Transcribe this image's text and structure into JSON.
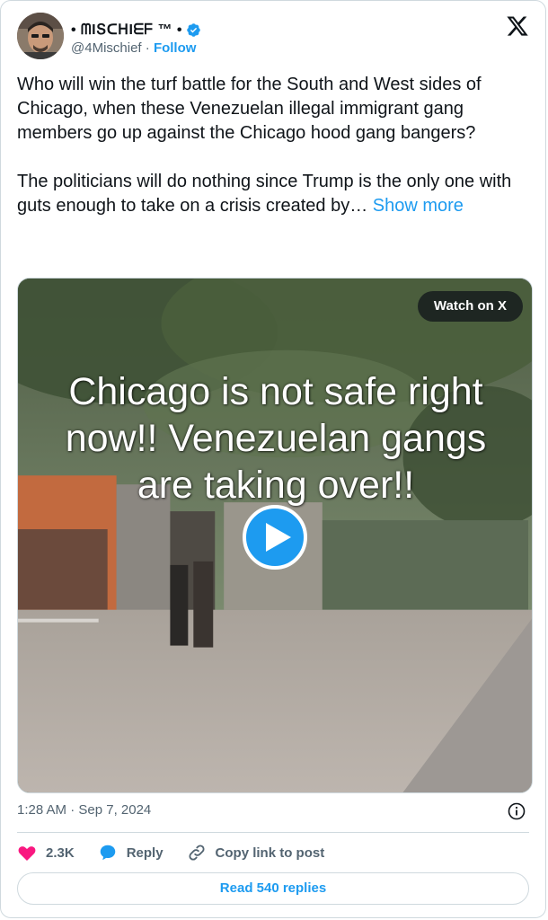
{
  "author": {
    "display_name": "• ᗰIՏᑕᕼIᗴᖴ ™ •",
    "handle": "@4Mischief",
    "separator": "·",
    "follow_label": "Follow"
  },
  "tweet": {
    "text": "Who will win the turf battle for the South and West sides of Chicago, when these Venezuelan illegal immigrant gang members go up against the Chicago hood gang bangers?\n\nThe politicians will do nothing since Trump is the only one with guts enough to take on a crisis created by… ",
    "show_more_label": "Show more"
  },
  "media": {
    "overlay_line1": "Chicago is not safe right",
    "overlay_line2": "now!!  Venezuelan gangs",
    "overlay_line3": "are taking over!!",
    "watch_label": "Watch on X"
  },
  "meta": {
    "timestamp": "1:28 AM · Sep 7, 2024"
  },
  "actions": {
    "like_count": "2.3K",
    "reply_label": "Reply",
    "copy_label": "Copy link to post"
  },
  "footer": {
    "read_replies_label": "Read 540 replies"
  },
  "colors": {
    "accent": "#1d9bf0",
    "like": "#f91880",
    "text": "#0f1419",
    "muted": "#536471"
  }
}
